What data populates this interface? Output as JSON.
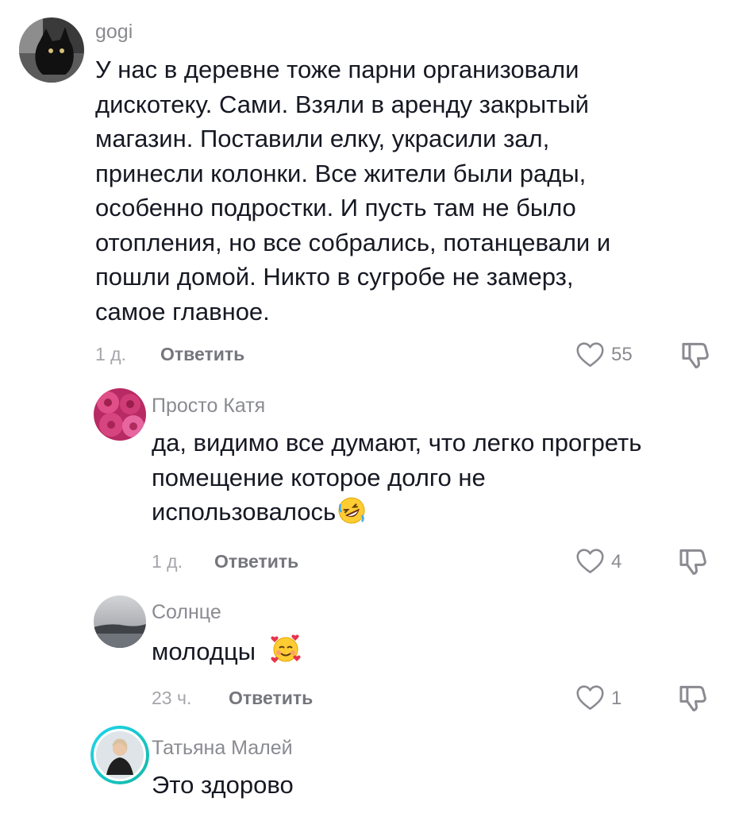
{
  "comments": [
    {
      "username": "gogi",
      "lines": [
        "У нас в деревне тоже парни организовали",
        "дискотеку. Сами. Взяли в аренду закрытый",
        "магазин. Поставили елку, украсили зал,",
        "принесли колонки. Все жители были рады,",
        "особенно подростки. И пусть там не было",
        "отопления, но все собрались, потанцевали и",
        "пошли домой. Никто в сугробе не замерз,",
        "самое главное."
      ],
      "time": "1 д.",
      "reply_label": "Ответить",
      "likes": "55"
    },
    {
      "username": "Просто Катя",
      "lines": [
        "да, видимо все думают, что легко прогреть",
        "помещение которое долго не",
        "использовалось"
      ],
      "emoji": "rolling-on-floor-laughing-emoji",
      "time": "1 д.",
      "reply_label": "Ответить",
      "likes": "4"
    },
    {
      "username": "Солнце",
      "lines": [
        "молодцы"
      ],
      "emoji": "smiling-face-with-hearts-emoji",
      "time": "23 ч.",
      "reply_label": "Ответить",
      "likes": "1"
    },
    {
      "username": "Татьяна Малей",
      "lines": [
        "Это здорово"
      ]
    }
  ]
}
